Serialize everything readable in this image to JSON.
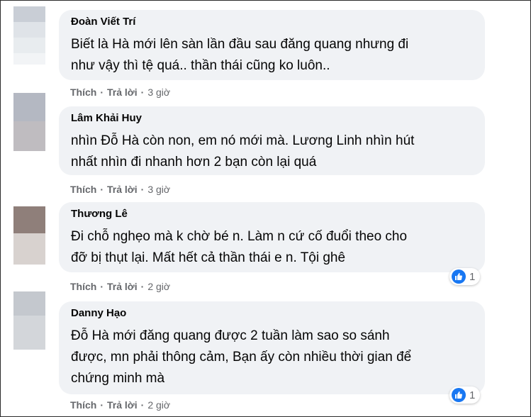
{
  "colors": {
    "bubble_bg": "#f0f2f5",
    "name_text": "#050505",
    "meta_text": "#65676b",
    "like_blue": "#1877f2"
  },
  "comments": [
    {
      "author": "Đoàn Viết Trí",
      "lines": [
        "Biết là Hà mới lên sàn lần đầu sau đăng quang nhưng đi",
        "như vậy thì tệ quá.. thần thái cũng ko luôn.."
      ],
      "like_label": "Thích",
      "reply_label": "Trả lời",
      "time": "3 giờ",
      "reactions": null
    },
    {
      "author": "Lâm Khải Huy",
      "lines": [
        "nhìn Đỗ Hà còn non, em nó mới mà. Lương Linh nhìn hút",
        "nhất nhìn đi nhanh hơn 2 bạn còn lại quá"
      ],
      "like_label": "Thích",
      "reply_label": "Trả lời",
      "time": "3 giờ",
      "reactions": null
    },
    {
      "author": "Thương Lê",
      "lines": [
        "Đi chỗ nghẹo mà k chờ bé n. Làm n cứ cố đuổi theo cho",
        "đỡ bị thụt lại. Mất hết cả thần thái e n. Tội ghê"
      ],
      "like_label": "Thích",
      "reply_label": "Trả lời",
      "time": "2 giờ",
      "reactions": {
        "icon": "like-icon",
        "count": "1"
      }
    },
    {
      "author": "Danny Hạo",
      "lines": [
        "Đỗ Hà mới đăng quang được 2 tuần làm sao so sánh",
        "được, mn phải thông cảm, Bạn ấy còn nhiều thời gian để",
        "chứng minh mà"
      ],
      "like_label": "Thích",
      "reply_label": "Trả lời",
      "time": "2 giờ",
      "reactions": {
        "icon": "like-icon",
        "count": "1"
      }
    }
  ]
}
